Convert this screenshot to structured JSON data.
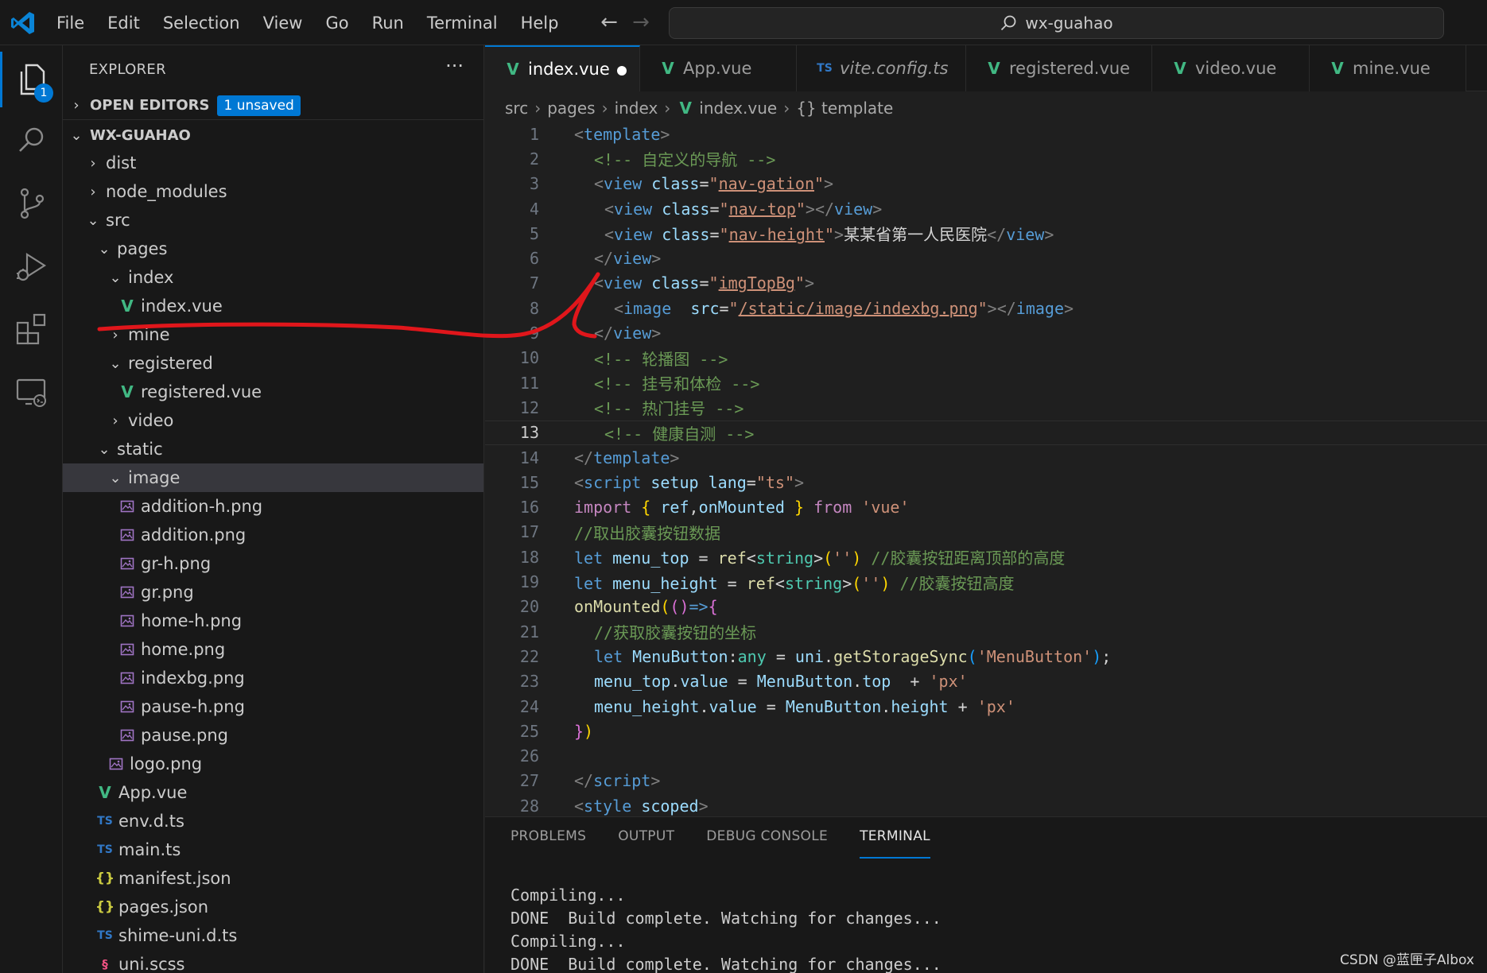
{
  "titlebar": {
    "menus": [
      "File",
      "Edit",
      "Selection",
      "View",
      "Go",
      "Run",
      "Terminal",
      "Help"
    ],
    "search_text": "wx-guahao"
  },
  "activity": {
    "explorer_badge": "1"
  },
  "sidebar": {
    "header": "EXPLORER",
    "open_editors_label": "OPEN EDITORS",
    "unsaved_badge": "1 unsaved",
    "project_label": "WX-GUAHAO",
    "tree": [
      {
        "label": "dist",
        "icon": "chevron-right"
      },
      {
        "label": "node_modules",
        "icon": "chevron-right"
      },
      {
        "label": "src",
        "icon": "chevron-down"
      },
      {
        "label": "pages",
        "icon": "chevron-down"
      },
      {
        "label": "index",
        "icon": "chevron-down"
      },
      {
        "label": "index.vue",
        "icon": "vue"
      },
      {
        "label": "mine",
        "icon": "chevron-right"
      },
      {
        "label": "registered",
        "icon": "chevron-down"
      },
      {
        "label": "registered.vue",
        "icon": "vue"
      },
      {
        "label": "video",
        "icon": "chevron-right"
      },
      {
        "label": "static",
        "icon": "chevron-down"
      },
      {
        "label": "image",
        "icon": "chevron-down"
      },
      {
        "label": "addition-h.png",
        "icon": "image"
      },
      {
        "label": "addition.png",
        "icon": "image"
      },
      {
        "label": "gr-h.png",
        "icon": "image"
      },
      {
        "label": "gr.png",
        "icon": "image"
      },
      {
        "label": "home-h.png",
        "icon": "image"
      },
      {
        "label": "home.png",
        "icon": "image"
      },
      {
        "label": "indexbg.png",
        "icon": "image"
      },
      {
        "label": "pause-h.png",
        "icon": "image"
      },
      {
        "label": "pause.png",
        "icon": "image"
      },
      {
        "label": "logo.png",
        "icon": "image"
      },
      {
        "label": "App.vue",
        "icon": "vue"
      },
      {
        "label": "env.d.ts",
        "icon": "ts"
      },
      {
        "label": "main.ts",
        "icon": "ts"
      },
      {
        "label": "manifest.json",
        "icon": "json"
      },
      {
        "label": "pages.json",
        "icon": "json"
      },
      {
        "label": "shime-uni.d.ts",
        "icon": "ts"
      },
      {
        "label": "uni.scss",
        "icon": "scss"
      }
    ]
  },
  "tabs": [
    {
      "label": "index.vue",
      "icon": "vue"
    },
    {
      "label": "App.vue",
      "icon": "vue"
    },
    {
      "label": "vite.config.ts",
      "icon": "ts",
      "icon_text": "TS"
    },
    {
      "label": "registered.vue",
      "icon": "vue"
    },
    {
      "label": "video.vue",
      "icon": "vue"
    },
    {
      "label": "mine.vue",
      "icon": "vue"
    }
  ],
  "breadcrumb": [
    "src",
    "pages",
    "index",
    "index.vue",
    "{} template"
  ],
  "code": {
    "line_numbers": [
      "1",
      "2",
      "3",
      "4",
      "5",
      "6",
      "7",
      "8",
      "9",
      "10",
      "11",
      "12",
      "13",
      "14",
      "15",
      "16",
      "17",
      "18",
      "19",
      "20",
      "21",
      "22",
      "23",
      "24",
      "25",
      "26",
      "27",
      "28"
    ],
    "current_line": "13",
    "tokens": {
      "template": "template",
      "view": "view",
      "class": "class",
      "nav_gation": "nav-gation",
      "nav_top": "nav-top",
      "nav_height": "nav-height",
      "hospital": "某某省第一人民医院",
      "imgTopBg": "imgTopBg",
      "image": "image",
      "src": "src",
      "img_path": "/static/image/indexbg.png",
      "c_nav": "<!-- 自定义的导航 -->",
      "c_carousel": "<!-- 轮播图 -->",
      "c_register": "<!-- 挂号和体检 -->",
      "c_hot": "<!-- 热门挂号 -->",
      "c_health": "<!-- 健康自测 -->",
      "script": "script",
      "setup": "setup",
      "lang": "lang",
      "ts": "ts",
      "import": "import",
      "ref": "ref",
      "onMounted": "onMounted",
      "from": "from",
      "vue": "'vue'",
      "c_capsule": "//取出胶囊按钮数据",
      "let": "let",
      "menu_top": "menu_top",
      "menu_height": "menu_height",
      "string": "string",
      "empty": "''",
      "c_top": "//胶囊按钮距离顶部的高度",
      "c_height": "//胶囊按钮高度",
      "c_coord": "//获取胶囊按钮的坐标",
      "MenuButton": "MenuButton",
      "any": "any",
      "uni": "uni",
      "getStorageSync": "getStorageSync",
      "MenuButton_str": "'MenuButton'",
      "value": "value",
      "top": "top",
      "height": "height",
      "px": "'px'",
      "style": "style",
      "scoped": "scoped"
    }
  },
  "panel": {
    "tabs": [
      "PROBLEMS",
      "OUTPUT",
      "DEBUG CONSOLE",
      "TERMINAL"
    ],
    "terminal_lines": [
      "Compiling...",
      "DONE  Build complete. Watching for changes...",
      "Compiling...",
      "DONE  Build complete. Watching for changes..."
    ]
  },
  "watermark": "CSDN @蓝匣子Albox",
  "colors": {
    "accent": "#0078d4",
    "vue_green": "#41b883",
    "annotation_red": "#e0161b"
  }
}
